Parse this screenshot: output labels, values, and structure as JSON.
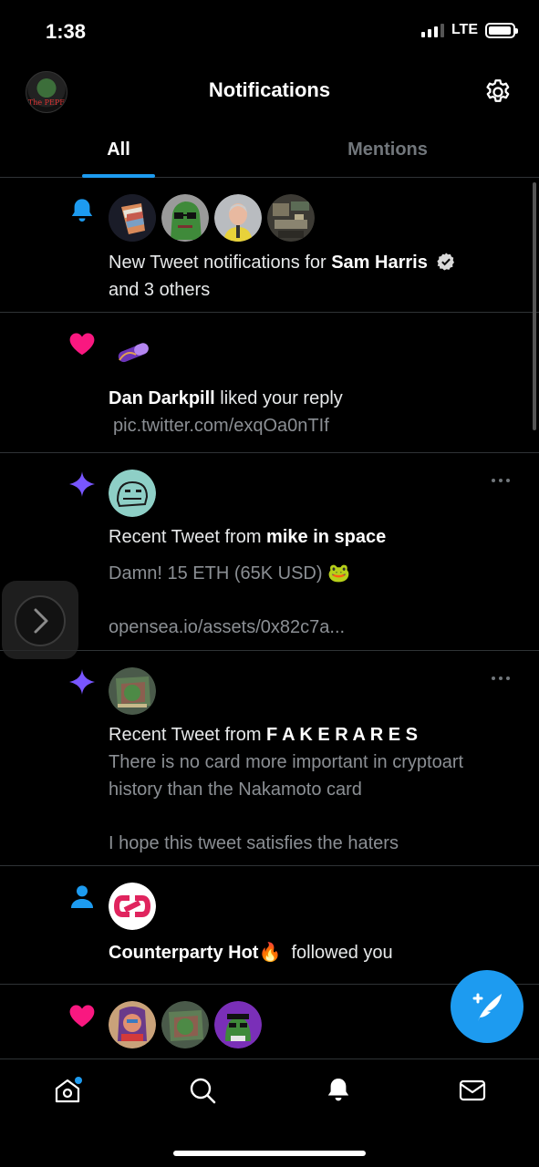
{
  "status_bar": {
    "time": "1:38",
    "network": "LTE"
  },
  "header": {
    "title": "Notifications",
    "avatar_text": "The PEPE"
  },
  "tabs": [
    {
      "label": "All"
    },
    {
      "label": "Mentions"
    }
  ],
  "notifications": [
    {
      "icon": "bell-icon",
      "prefix": "New Tweet notifications for ",
      "name": "Sam Harris",
      "suffix": "and 3 others"
    },
    {
      "icon": "heart-icon",
      "name": "Dan Darkpill",
      "action": " liked your reply",
      "detail": "pic.twitter.com/exqOa0nTIf"
    },
    {
      "icon": "sparkle-icon",
      "prefix": "Recent Tweet from ",
      "name": "mike in space",
      "body_line1": "Damn! 15 ETH (65K USD) 🐸",
      "body_line2": "opensea.io/assets/0x82c7a..."
    },
    {
      "icon": "sparkle-icon",
      "prefix": "Recent Tweet from ",
      "name": "F A K E R A R E S",
      "body_line1": "There is no card more important in cryptoart history than the Nakamoto card",
      "body_line2": "I hope this tweet satisfies the haters"
    },
    {
      "icon": "person-icon",
      "name": "Counterparty Hot🔥",
      "action": "  followed you"
    },
    {
      "icon": "heart-icon"
    }
  ],
  "colors": {
    "accent": "#1d9bf0",
    "like": "#f91880",
    "sparkle": "#7856ff",
    "divider": "#2f3336",
    "muted_text": "#71767b"
  },
  "bottom_nav": [
    {
      "icon": "home-icon",
      "has_badge": true
    },
    {
      "icon": "search-icon"
    },
    {
      "icon": "notifications-bell-icon",
      "active": true
    },
    {
      "icon": "mail-icon"
    }
  ],
  "fab": {
    "icon": "compose-tweet-icon"
  }
}
